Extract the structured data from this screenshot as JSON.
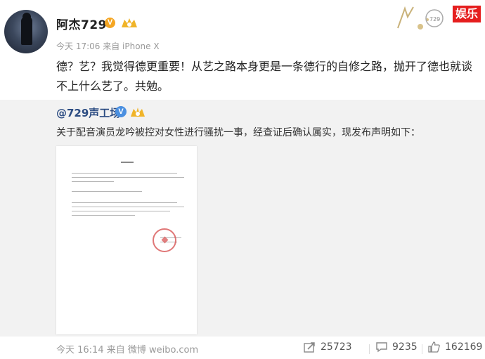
{
  "post": {
    "username": "阿杰729",
    "verified_badge": "V",
    "level_icon": "level-badge-icon",
    "meta": "今天 17:06 来自 iPhone X",
    "text": "德？艺？我觉得德更重要！从艺之路本身更是一条德行的自修之路，抛开了德也就谈不上什么艺了。共勉。"
  },
  "overlay": {
    "channel_tag": "娱乐"
  },
  "repost": {
    "username": "@729声工场",
    "verified_badge": "V",
    "text": "关于配音演员龙吟被控对女性进行骚扰一事，经查证后确认属实，现发布声明如下：",
    "attachment_icon": "document-image"
  },
  "footer": {
    "meta": "今天 16:14 来自 微博 weibo.com",
    "repost_count": "25723",
    "comment_count": "9235",
    "like_count": "162169"
  },
  "colors": {
    "repost_bg": "#f2f2f2",
    "link_blue": "#2c4c82",
    "vip_orange": "#f5a623",
    "tag_red": "#e51e1e"
  }
}
